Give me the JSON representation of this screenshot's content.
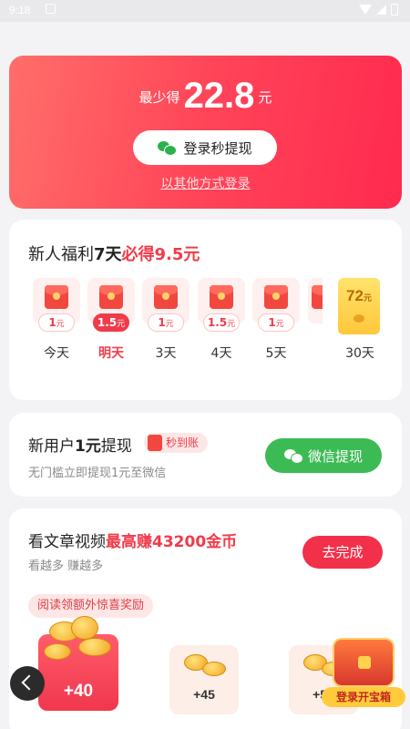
{
  "status_bar": {
    "time": "9:18"
  },
  "hero": {
    "prefix": "最少得",
    "amount": "22.8",
    "unit": "元",
    "login_button": "登录秒提现",
    "other_login": "以其他方式登录"
  },
  "newbie": {
    "title_a": "新人福利",
    "title_b": "7天",
    "title_c": "必得9.5元",
    "days": [
      {
        "amount": "1",
        "unit": "元",
        "label": "今天"
      },
      {
        "amount": "1.5",
        "unit": "元",
        "label": "明天"
      },
      {
        "amount": "1",
        "unit": "元",
        "label": "3天"
      },
      {
        "amount": "1.5",
        "unit": "元",
        "label": "4天"
      },
      {
        "amount": "1",
        "unit": "元",
        "label": "5天"
      }
    ],
    "final_day": {
      "amount": "72",
      "unit": "元",
      "label": "30天"
    }
  },
  "withdraw": {
    "title_a": "新用户",
    "title_b": "1元",
    "title_c": "提现",
    "badge": "秒到账",
    "subtitle": "无门槛立即提现1元至微信",
    "button": "微信提现"
  },
  "articles": {
    "title_a": "看文章视频",
    "title_b": "最高赚43200金币",
    "subtitle": "看越多 赚越多",
    "button": "去完成",
    "tag": "阅读领额外惊喜奖励",
    "rewards": [
      "+40",
      "+45",
      "+50"
    ],
    "treasure_label": "登录开宝箱"
  },
  "colors": {
    "accent_red": "#f03b4a",
    "wechat_green": "#3cbb54"
  }
}
